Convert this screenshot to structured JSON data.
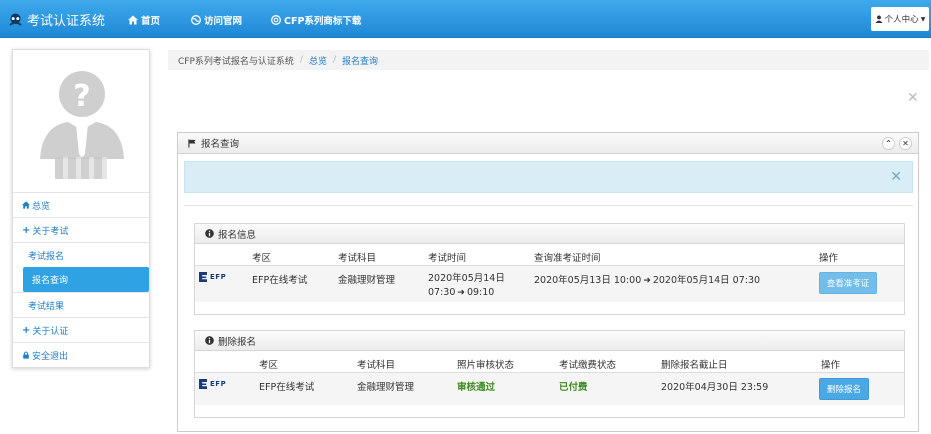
{
  "app": {
    "title": "考试认证系统"
  },
  "nav": {
    "home": "首页",
    "official": "访问官网",
    "trademark": "CFP系列商标下载",
    "user_menu": "个人中心"
  },
  "sidebar": {
    "items": [
      {
        "label": "总览"
      },
      {
        "label": "关于考试"
      },
      {
        "label": "考试报名"
      },
      {
        "label": "报名查询"
      },
      {
        "label": "考试结果"
      },
      {
        "label": "关于认证"
      },
      {
        "label": "安全退出"
      }
    ]
  },
  "breadcrumb": {
    "root": "CFP系列考试报名与认证系统",
    "overview": "总览",
    "current": "报名查询"
  },
  "panel": {
    "title": "报名查询"
  },
  "info_box": {
    "title": "报名信息",
    "headers": [
      "考区",
      "考试科目",
      "考试时间",
      "查询准考证时间",
      "操作"
    ],
    "row": {
      "logo_text": "EFP",
      "area": "EFP在线考试",
      "subject": "金融理财管理",
      "exam_date": "2020年05月14日",
      "exam_start": "07:30",
      "exam_end": "09:10",
      "query_start": "2020年05月13日 10:00",
      "query_end": "2020年05月14日 07:30",
      "button": "查看准考证"
    }
  },
  "delete_box": {
    "title": "删除报名",
    "headers": [
      "考区",
      "考试科目",
      "照片审核状态",
      "考试缴费状态",
      "删除报名截止日",
      "操作"
    ],
    "row": {
      "logo_text": "EFP",
      "area": "EFP在线考试",
      "subject": "金融理财管理",
      "photo_status": "审核通过",
      "pay_status": "已付费",
      "deadline": "2020年04月30日 23:59",
      "button": "删除报名"
    }
  },
  "colors": {
    "nav": "#1e88d6",
    "accent": "#2fa2e3",
    "success": "#3c8a1f",
    "alert_bg": "#d9edf7"
  }
}
